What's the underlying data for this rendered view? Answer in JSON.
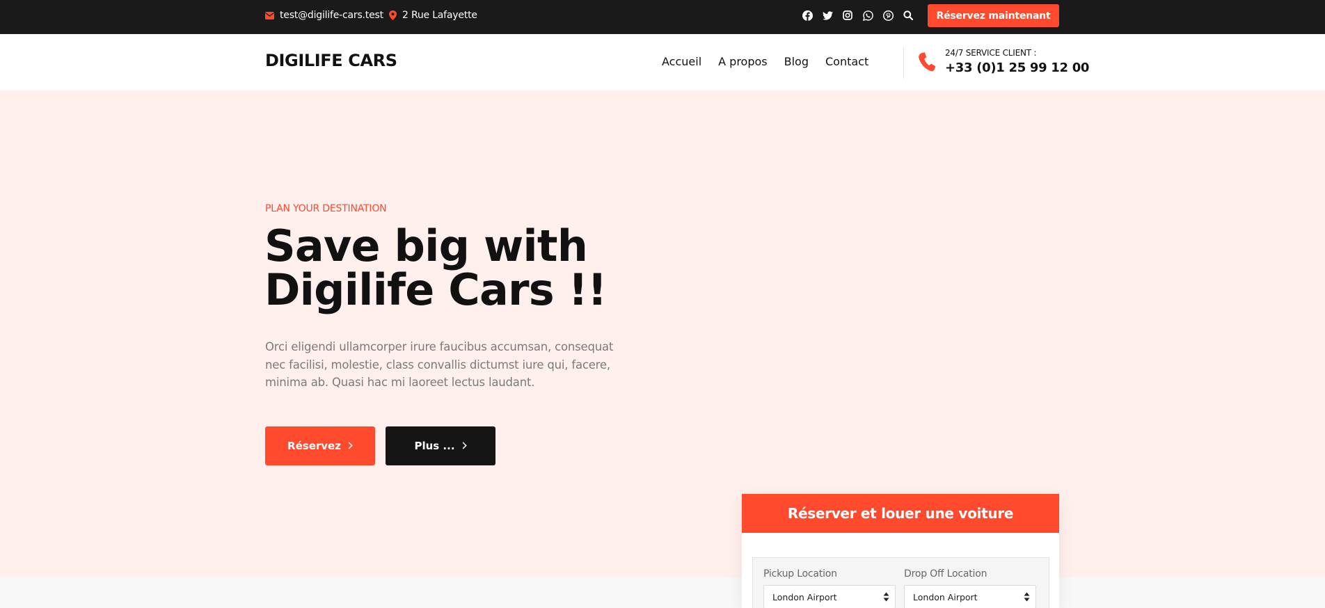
{
  "topbar": {
    "email": "test@digilife-cars.test",
    "address": "2 Rue Lafayette",
    "social": [
      "facebook-icon",
      "twitter-icon",
      "instagram-icon",
      "whatsapp-icon",
      "pinterest-icon",
      "search-icon"
    ],
    "cta_label": "Réservez maintenant"
  },
  "header": {
    "logo": "DIGILIFE CARS",
    "nav": [
      "Accueil",
      "A propos",
      "Blog",
      "Contact"
    ],
    "service_label": "24/7 SERVICE CLIENT :",
    "service_phone": "+33 (0)1 25 99 12 00"
  },
  "hero": {
    "eyebrow": "PLAN YOUR DESTINATION",
    "headline_line1": "Save big with",
    "headline_line2": "Digilife Cars !!",
    "lead": "Orci eligendi ullamcorper irure faucibus accumsan, consequat nec facilisi, molestie, class convallis dictumst iure qui, facere, minima ab. Quasi hac mi laoreet lectus laudant.",
    "primary_label": "Réservez",
    "secondary_label": "Plus ..."
  },
  "booking": {
    "title": "Réserver et louer une voiture",
    "pickup_label": "Pickup Location",
    "pickup_value": "London Airport",
    "dropoff_label": "Drop Off Location",
    "dropoff_value": "London Airport"
  },
  "colors": {
    "accent": "#ff4a2d",
    "dark": "#1a1a1a",
    "hero_bg": "#ffefed"
  }
}
